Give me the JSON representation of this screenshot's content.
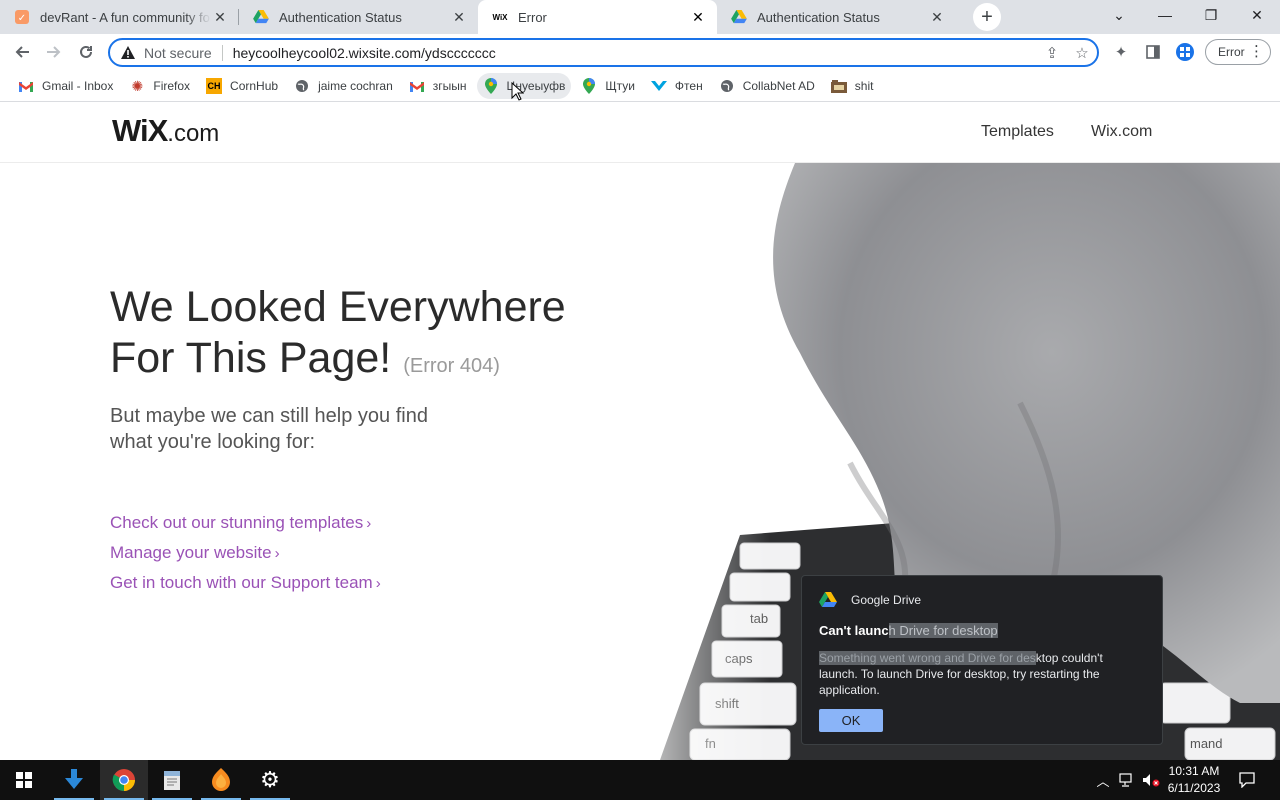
{
  "browser": {
    "tabs": [
      {
        "title": "devRant - A fun community for developers",
        "icon": "devrant-icon",
        "active": false
      },
      {
        "title": "Authentication Status",
        "icon": "google-drive-icon",
        "active": false
      },
      {
        "title": "Error",
        "icon": "wix-icon",
        "active": true
      },
      {
        "title": "Authentication Status",
        "icon": "google-drive-icon",
        "active": false
      }
    ],
    "omnibox": {
      "security_label": "Not secure",
      "url": "heycoolheycool02.wixsite.com/ydsccccccc"
    },
    "profile_label": "Error",
    "bookmarks": [
      {
        "label": "Gmail - Inbox",
        "icon": "gmail-icon"
      },
      {
        "label": "Firefox",
        "icon": "firefox-icon"
      },
      {
        "label": "CornHub",
        "icon": "cornhub-icon"
      },
      {
        "label": "jaime cochran",
        "icon": "globe-icon"
      },
      {
        "label": "згыын",
        "icon": "gmail-icon"
      },
      {
        "label": "Цнуеыуфв",
        "icon": "maps-pin-icon"
      },
      {
        "label": "Щтуи",
        "icon": "maps-pin-icon"
      },
      {
        "label": "Фтен",
        "icon": "arrow-down-icon"
      },
      {
        "label": "CollabNet AD",
        "icon": "globe-icon"
      },
      {
        "label": "shit",
        "icon": "folder-icon"
      }
    ]
  },
  "wix": {
    "logo_main": "WiX",
    "logo_suffix": ".com",
    "nav": [
      "Templates",
      "Wix.com"
    ],
    "heading_line1": "We Looked Everywhere",
    "heading_line2": "For This Page!",
    "error_code": "(Error 404)",
    "sub_line1": "But maybe we can still help you find",
    "sub_line2": "what you're looking for:",
    "links": [
      "Check out our stunning templates",
      "Manage your website",
      "Get in touch with our Support team"
    ],
    "link_chevron": "›"
  },
  "drive_dialog": {
    "app": "Google Drive",
    "title_plain": "Can't launc",
    "title_highlight": "h Drive for desktop",
    "body_highlight": "Something went wrong and Drive for des",
    "body_rest": "ktop couldn't launch. To launch Drive for desktop, try restarting the application.",
    "ok_label": "OK"
  },
  "taskbar": {
    "time": "10:31 AM",
    "date": "6/11/2023",
    "apps": [
      "start-icon",
      "download-app-icon",
      "chrome-icon",
      "notepad-icon",
      "fl-studio-icon",
      "settings-icon"
    ]
  }
}
